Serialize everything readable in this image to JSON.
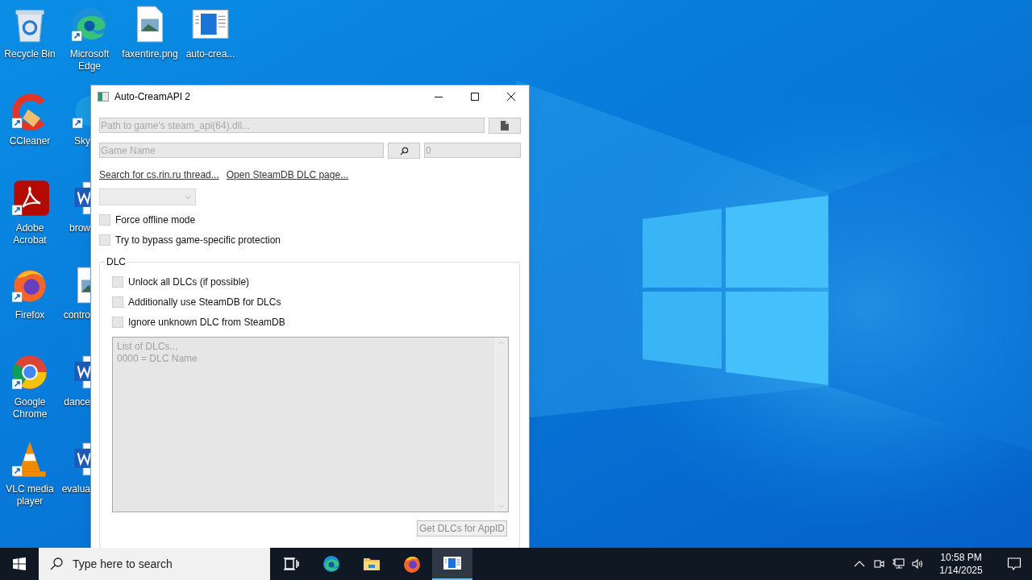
{
  "desktop_icons": [
    {
      "kind": "recycle",
      "label": "Recycle Bin"
    },
    {
      "kind": "edge",
      "label": "Microsoft Edge",
      "shortcut": true
    },
    {
      "kind": "image-file",
      "label": "faxentire.png"
    },
    {
      "kind": "app-file",
      "label": "auto-crea..."
    },
    {
      "kind": "ccleaner",
      "label": "CCleaner",
      "shortcut": true
    },
    {
      "kind": "skype",
      "label": "Sky",
      "shortcut": true
    },
    {
      "kind": "acrobat",
      "label": "Adobe Acrobat",
      "shortcut": true
    },
    {
      "kind": "word",
      "label": "brow"
    },
    {
      "kind": "firefox",
      "label": "Firefox",
      "shortcut": true
    },
    {
      "kind": "image-file",
      "label": "contro"
    },
    {
      "kind": "chrome",
      "label": "Google Chrome",
      "shortcut": true
    },
    {
      "kind": "word",
      "label": "dance"
    },
    {
      "kind": "vlc",
      "label": "VLC media player",
      "shortcut": true
    },
    {
      "kind": "word",
      "label": "evalua"
    }
  ],
  "window": {
    "title": "Auto-CreamAPI 2",
    "path_field": {
      "placeholder": "Path to game's steam_api(64).dll..."
    },
    "game_name_field": {
      "placeholder": "Game Name"
    },
    "appid_field": {
      "placeholder": "0"
    },
    "links": [
      "Search for cs.rin.ru thread...",
      "Open SteamDB DLC page..."
    ],
    "dropdown": {
      "disabled": true
    },
    "options": [
      {
        "label": "Force offline mode",
        "checked": false
      },
      {
        "label": "Try to bypass game-specific protection",
        "checked": false
      }
    ],
    "dlc_group": {
      "title": "DLC",
      "options": [
        {
          "label": "Unlock all DLCs (if possible)",
          "checked": false
        },
        {
          "label": "Additionally use SteamDB for DLCs",
          "checked": false
        },
        {
          "label": "Ignore unknown DLC from SteamDB",
          "checked": false
        }
      ],
      "dlc_list": {
        "placeholder": "List of DLCs...\n0000 = DLC Name"
      },
      "get_button": {
        "label": "Get DLCs for AppID",
        "disabled": true
      }
    }
  },
  "taskbar": {
    "search": {
      "placeholder": "Type here to search"
    },
    "apps": [
      {
        "kind": "taskview",
        "active": false
      },
      {
        "kind": "edge",
        "active": false
      },
      {
        "kind": "explorer",
        "active": false
      },
      {
        "kind": "firefox",
        "active": false
      },
      {
        "kind": "app",
        "active": true
      }
    ],
    "clock": {
      "time": "10:58 PM",
      "date": "1/14/2025"
    }
  }
}
